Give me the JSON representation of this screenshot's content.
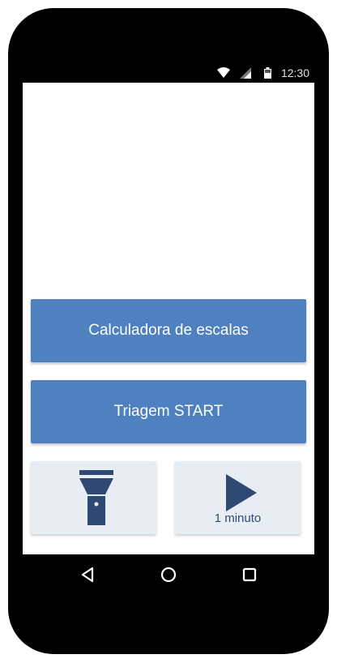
{
  "status_bar": {
    "time": "12:30",
    "icons": [
      "wifi-icon",
      "signal-icon",
      "battery-icon"
    ]
  },
  "main": {
    "scale_calculator_label": "Calculadora de escalas",
    "triage_start_label": "Triagem START",
    "flashlight_icon": "flashlight-icon",
    "timer": {
      "icon": "play-icon",
      "label": "1 minuto"
    }
  },
  "nav_bar": {
    "icons": [
      "back-icon",
      "home-icon",
      "recents-icon"
    ]
  },
  "colors": {
    "primary_button": "#4f80bf",
    "tile_background": "#e8edf4",
    "icon_dark": "#2e4a72"
  }
}
